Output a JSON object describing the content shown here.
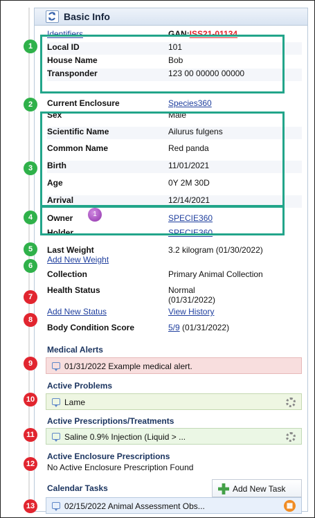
{
  "header": {
    "title": "Basic Info"
  },
  "fields": {
    "identifiers_label": "Identifiers",
    "gan_label": "GAN:",
    "gan_value": "ISS21-01134",
    "local_id_label": "Local ID",
    "local_id_value": "101",
    "house_name_label": "House Name",
    "house_name_value": "Bob",
    "transponder_label": "Transponder",
    "transponder_value": "123 00 00000 00000",
    "current_enclosure_label": "Current Enclosure",
    "current_enclosure_value": "Species360",
    "sex_label": "Sex",
    "sex_value": "Male",
    "scientific_name_label": "Scientific Name",
    "scientific_name_value": "Ailurus fulgens",
    "common_name_label": "Common Name",
    "common_name_value": "Red panda",
    "birth_label": "Birth",
    "birth_value": "11/01/2021",
    "age_label": "Age",
    "age_value": "0Y 2M 30D",
    "arrival_label": "Arrival",
    "arrival_value": "12/14/2021",
    "owner_label": "Owner",
    "owner_value": "SPECIE360",
    "holder_label": "Holder",
    "holder_value": "SPECIE360",
    "last_weight_label": "Last Weight",
    "last_weight_value": "3.2 kilogram (01/30/2022)",
    "add_weight_link": "Add New Weight",
    "collection_label": "Collection",
    "collection_value": "Primary Animal Collection",
    "health_status_label": "Health Status",
    "health_status_value": "Normal",
    "health_status_date": "(01/31/2022)",
    "add_status_link": "Add New Status",
    "view_history_link": "View History",
    "body_condition_label": "Body Condition Score",
    "body_condition_score": "5/9",
    "body_condition_date": "(01/31/2022)"
  },
  "sections": {
    "medical_alerts": "Medical Alerts",
    "medical_alert_text": "01/31/2022 Example medical alert.",
    "active_problems": "Active Problems",
    "active_problem_text": "Lame",
    "active_prescriptions": "Active Prescriptions/Treatments",
    "active_prescription_text": "Saline 0.9% Injection (Liquid > ...",
    "active_enclosure_prescriptions": "Active Enclosure Prescriptions",
    "enclosure_prescription_text": "No Active Enclosure Prescription Found",
    "calendar_tasks": "Calendar Tasks",
    "add_task_button": "Add New Task",
    "calendar_task_text": "02/15/2022 Animal Assessment Obs..."
  },
  "badges": [
    "1",
    "2",
    "3",
    "4",
    "5",
    "6",
    "7",
    "8",
    "9",
    "10",
    "11",
    "12",
    "13"
  ],
  "small_badge": "1",
  "colors": {
    "teal": "#22a58a",
    "green": "#2fb14a",
    "red": "#e1252f",
    "alert_bg": "#f8dede",
    "problem_bg": "#eef6e2",
    "prescription_bg": "#ebf7e5",
    "task_bg": "#e8f0fb"
  }
}
